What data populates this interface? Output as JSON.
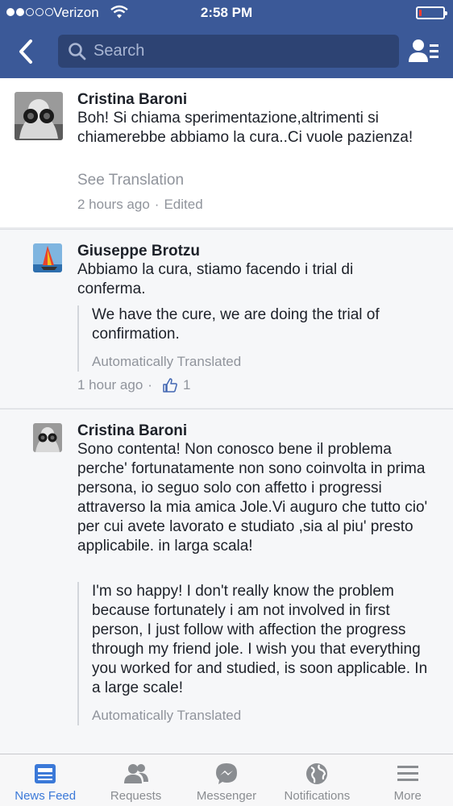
{
  "status_bar": {
    "carrier": "Verizon",
    "time": "2:58 PM",
    "signal_bars_filled": 2,
    "signal_bars_total": 5,
    "battery_level": 0.1
  },
  "header": {
    "search_placeholder": "Search",
    "icons": [
      "back-chevron-icon",
      "search-icon",
      "friend-list-icon"
    ],
    "colors": {
      "bar": "#3b5998",
      "search_bg": "#2d4373"
    }
  },
  "comments": [
    {
      "author": "Cristina Baroni",
      "text": "Boh! Si chiama sperimentazione,altrimenti si chiamerebbe abbiamo la cura..Ci vuole pazienza!",
      "see_translation": "See Translation",
      "time": "2 hours ago",
      "edited": "Edited"
    },
    {
      "author": "Giuseppe Brotzu",
      "text": "Abbiamo la cura, stiamo facendo i trial di conferma.",
      "translation": "We have the cure, we are doing the trial of confirmation.",
      "auto_translated": "Automatically Translated",
      "time": "1 hour ago",
      "likes": "1"
    },
    {
      "author": "Cristina Baroni",
      "text": "Sono contenta!  Non conosco bene il problema perche' fortunatamente non sono coinvolta in prima persona, io seguo solo con affetto i progressi attraverso la mia amica Jole.Vi auguro che tutto cio' per cui avete lavorato e studiato ,sia al piu' presto applicabile. in larga scala!",
      "translation": "I'm so happy! I don't really know the problem because fortunately i am not involved in first person, I just follow with affection the progress through my friend jole. I wish you that everything you worked for and studied, is soon applicable. In a large scale!",
      "auto_translated": "Automatically Translated"
    }
  ],
  "tabs": [
    {
      "label": "News Feed",
      "icon": "news-feed-icon",
      "active": true
    },
    {
      "label": "Requests",
      "icon": "friend-requests-icon",
      "active": false
    },
    {
      "label": "Messenger",
      "icon": "messenger-icon",
      "active": false
    },
    {
      "label": "Notifications",
      "icon": "globe-icon",
      "active": false
    },
    {
      "label": "More",
      "icon": "menu-icon",
      "active": false
    }
  ]
}
